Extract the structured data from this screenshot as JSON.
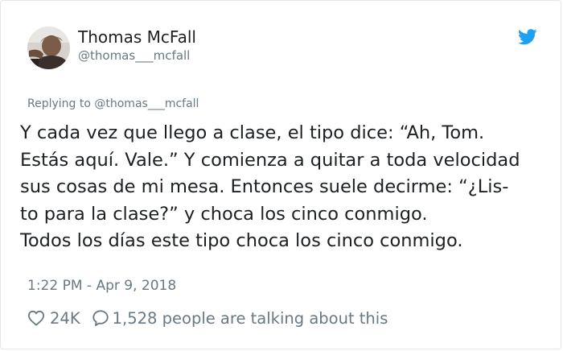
{
  "tweet": {
    "author_name": "Thomas McFall",
    "author_handle": "@thomas___mcfall",
    "replying_to": "Replying to @thomas___mcfall",
    "text_lines": [
      "Y cada vez que llego a clase, el tipo dice: “Ah, Tom.",
      "Estás aquí. Vale.” Y comienza a quitar a toda velocidad",
      "sus cosas de mi mesa. Entonces suele decirme: “¿Lis-",
      "to para la clase?” y choca los cinco conmigo.",
      "Todos los días este tipo choca los cinco conmigo."
    ],
    "timestamp": "1:22 PM - Apr 9, 2018",
    "like_count": "24K",
    "talking_text": "1,528 people are talking about this"
  },
  "icons": {
    "brand": "twitter-bird-icon",
    "like": "heart-icon",
    "comment": "speech-bubble-icon"
  },
  "colors": {
    "text": "#1c2022",
    "secondary_text": "#697882",
    "twitter_blue": "#1da1f2",
    "border": "#e1e8ed"
  }
}
